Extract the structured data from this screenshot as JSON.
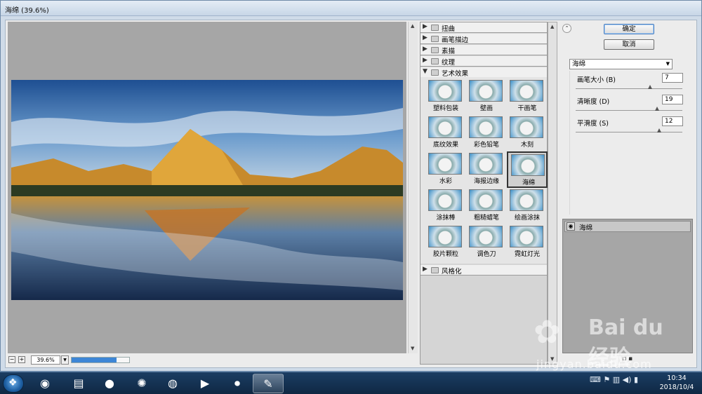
{
  "window": {
    "title": "海绵 (39.6%)"
  },
  "preview": {
    "zoom": "39.6%",
    "progress_fraction": 0.78
  },
  "gallery": {
    "categories_top": [
      "扭曲",
      "画笔描边",
      "素描",
      "纹理"
    ],
    "open_category": "艺术效果",
    "filters": [
      "塑料包装",
      "壁画",
      "干画笔",
      "底纹效果",
      "彩色铅笔",
      "木刻",
      "水彩",
      "海报边缘",
      "海绵",
      "涂抹棒",
      "粗糙蜡笔",
      "绘画涂抹",
      "胶片颗粒",
      "调色刀",
      "霓虹灯光"
    ],
    "selected_filter": "海绵",
    "categories_bottom": [
      "风格化"
    ]
  },
  "buttons": {
    "ok": "确定",
    "cancel": "取消"
  },
  "filter_select": {
    "value": "海绵"
  },
  "params": [
    {
      "label": "画笔大小 (B)",
      "value": "7",
      "fraction": 0.7
    },
    {
      "label": "清晰度 (D)",
      "value": "19",
      "fraction": 0.76
    },
    {
      "label": "平滑度 (S)",
      "value": "12",
      "fraction": 0.78
    }
  ],
  "layers": {
    "items": [
      "海绵"
    ]
  },
  "watermark": {
    "brand": "Bai du 经验",
    "url": "jingyan.baidu.com"
  },
  "taskbar": {
    "apps": [
      "ie-icon",
      "explorer-icon",
      "qq-icon",
      "media-icon",
      "firefox-icon",
      "game-icon",
      "record-icon",
      "photoshop-icon"
    ],
    "time": "10:34",
    "date": "2018/10/4"
  },
  "colors": {
    "accent": "#3d86d6",
    "taskbar": "#1b3d63",
    "preview_bg": "#a6a6a6"
  }
}
